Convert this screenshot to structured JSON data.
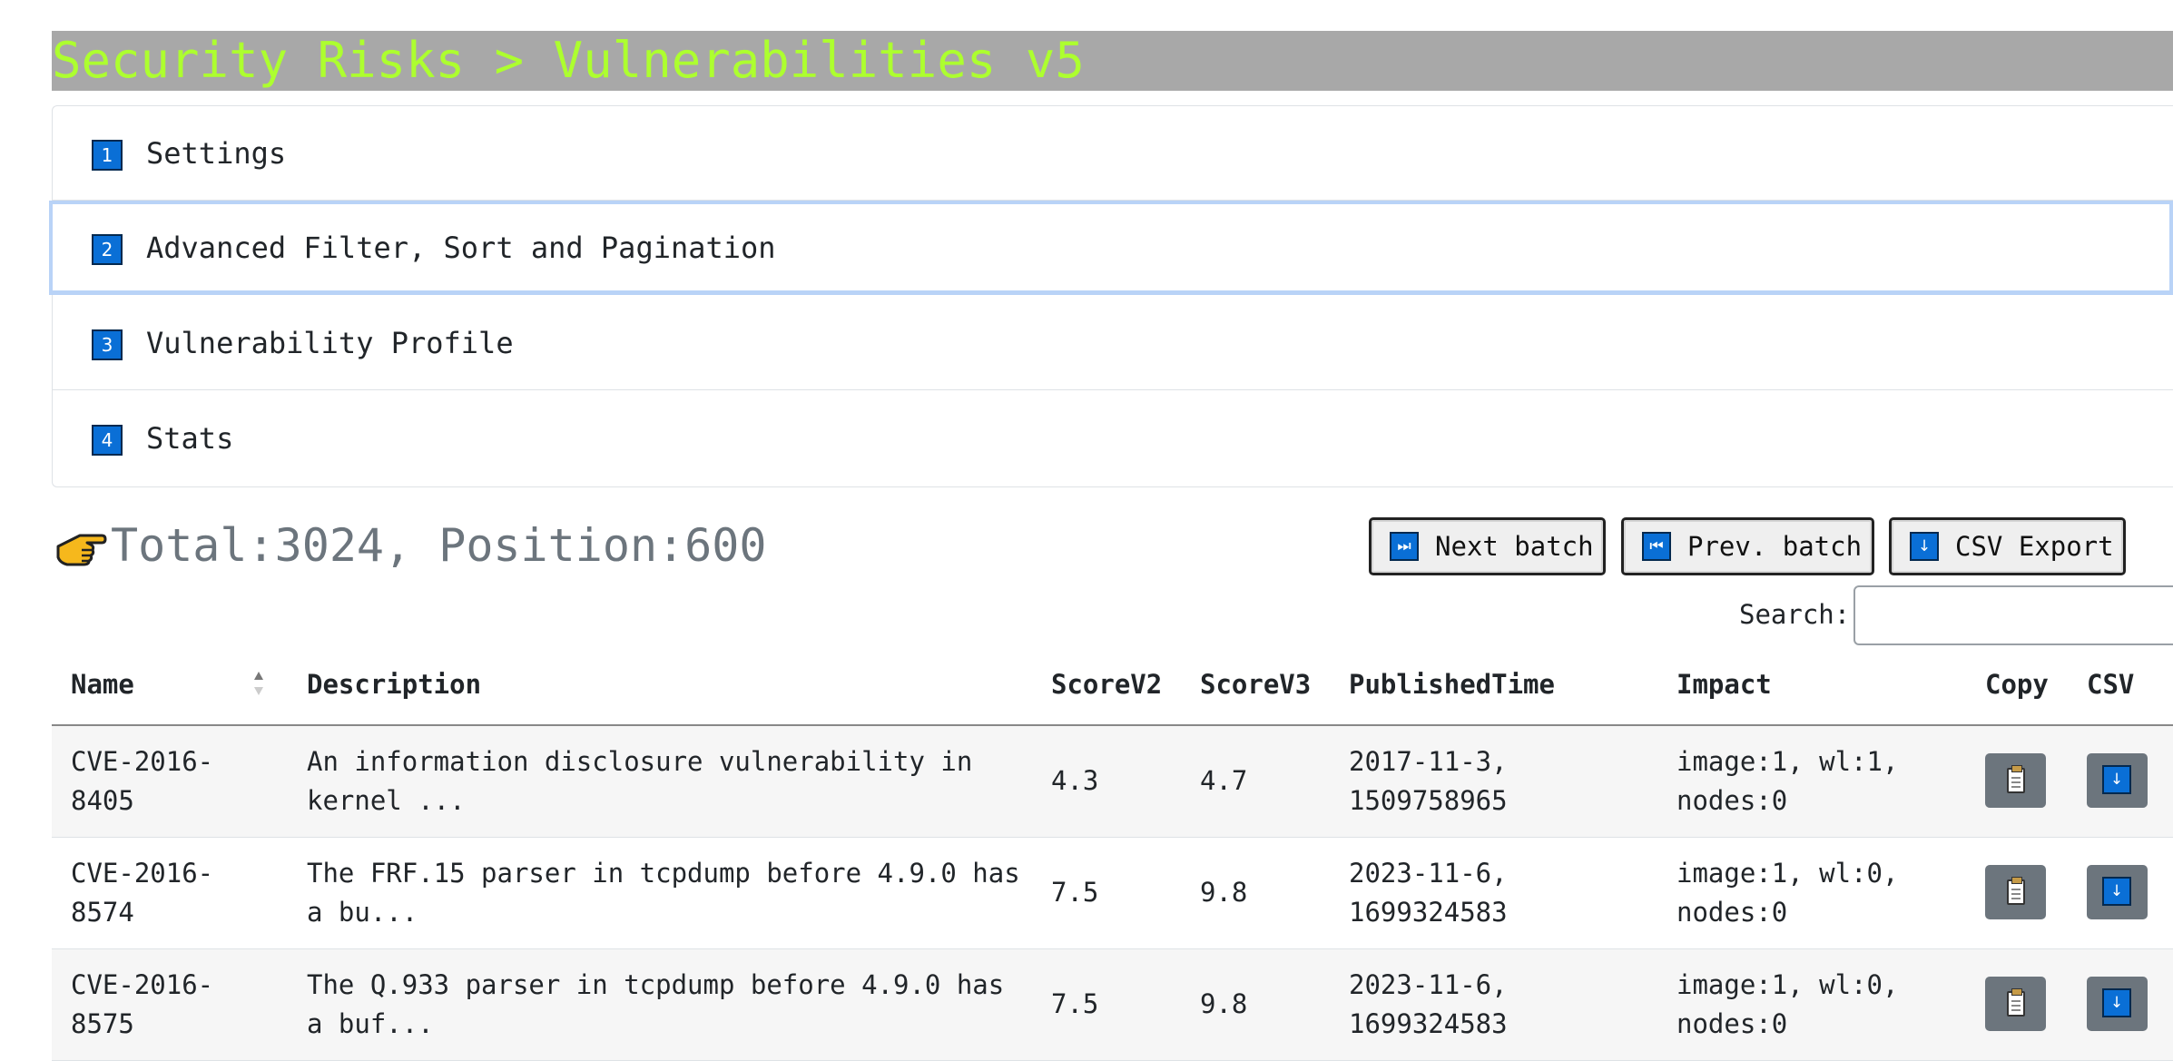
{
  "header": {
    "title": "Security Risks > Vulnerabilities v5"
  },
  "accordion": [
    {
      "num": "1",
      "label": "Settings"
    },
    {
      "num": "2",
      "label": "Advanced Filter, Sort and Pagination"
    },
    {
      "num": "3",
      "label": "Vulnerability Profile"
    },
    {
      "num": "4",
      "label": "Stats"
    }
  ],
  "summary": {
    "text": "Total:3024, Position:600"
  },
  "toolbar": {
    "next_label": "Next batch",
    "next_icon": "⏭",
    "prev_label": "Prev. batch",
    "prev_icon": "⏮",
    "csv_label": "CSV Export",
    "csv_icon": "↓"
  },
  "search": {
    "label": "Search:",
    "value": ""
  },
  "table": {
    "columns": [
      "Name",
      "Description",
      "ScoreV2",
      "ScoreV3",
      "PublishedTime",
      "Impact",
      "Copy",
      "CSV"
    ],
    "rows": [
      {
        "name": [
          "CVE-2016-",
          "8405"
        ],
        "description": [
          "An information disclosure vulnerability in",
          "kernel ..."
        ],
        "score_v2": "4.3",
        "score_v3": "4.7",
        "published": [
          "2017-11-3,",
          "1509758965"
        ],
        "impact": [
          "image:1, wl:1,",
          "nodes:0"
        ]
      },
      {
        "name": [
          "CVE-2016-",
          "8574"
        ],
        "description": [
          "The FRF.15 parser in tcpdump before 4.9.0 has",
          "a bu..."
        ],
        "score_v2": "7.5",
        "score_v3": "9.8",
        "published": [
          "2023-11-6,",
          "1699324583"
        ],
        "impact": [
          "image:1, wl:0,",
          "nodes:0"
        ]
      },
      {
        "name": [
          "CVE-2016-",
          "8575"
        ],
        "description": [
          "The Q.933 parser in tcpdump before 4.9.0 has",
          "a buf..."
        ],
        "score_v2": "7.5",
        "score_v3": "9.8",
        "published": [
          "2023-11-6,",
          "1699324583"
        ],
        "impact": [
          "image:1, wl:0,",
          "nodes:0"
        ]
      }
    ]
  },
  "colors": {
    "title_bg": "#a8a8a8",
    "title_text": "#adff2f",
    "icon_blue": "#0a6fd6",
    "icon_button_bg": "#6c757d"
  }
}
